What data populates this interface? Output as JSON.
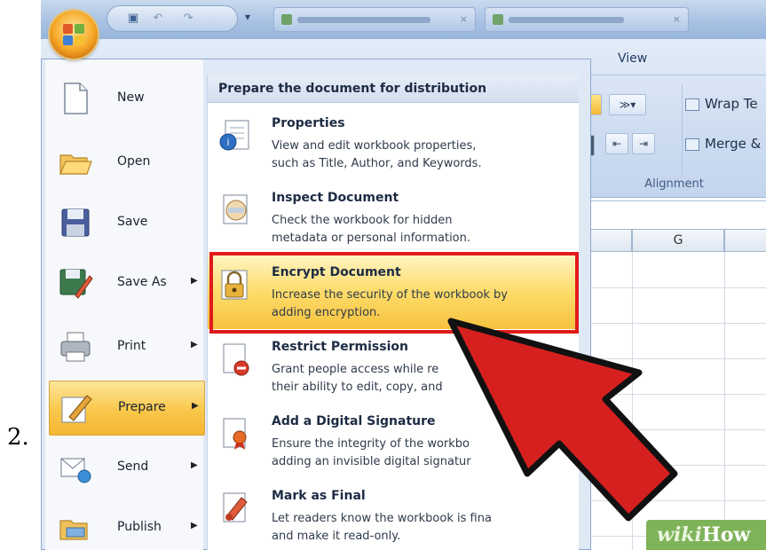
{
  "step_number": "2.",
  "ribbon": {
    "view_tab": "View",
    "wrap_text": "Wrap Te",
    "merge": "Merge &",
    "group_alignment": "Alignment",
    "column_g": "G"
  },
  "office_menu": {
    "left_items": [
      {
        "label": "New",
        "icon": "new-document-icon",
        "submenu": false
      },
      {
        "label": "Open",
        "icon": "open-folder-icon",
        "submenu": false
      },
      {
        "label": "Save",
        "icon": "save-disk-icon",
        "submenu": false
      },
      {
        "label": "Save As",
        "icon": "save-as-icon",
        "submenu": true
      },
      {
        "label": "Print",
        "icon": "printer-icon",
        "submenu": true
      },
      {
        "label": "Prepare",
        "icon": "prepare-pencil-icon",
        "submenu": true,
        "active": true
      },
      {
        "label": "Send",
        "icon": "send-icon",
        "submenu": true
      },
      {
        "label": "Publish",
        "icon": "publish-folder-icon",
        "submenu": true
      }
    ],
    "right_panel": {
      "heading": "Prepare the document for distribution",
      "entries": [
        {
          "title": "Properties",
          "line1": "View and edit workbook properties,",
          "line2": "such as Title, Author, and Keywords.",
          "icon": "properties-icon"
        },
        {
          "title": "Inspect Document",
          "line1": "Check the workbook for hidden",
          "line2": "metadata or personal information.",
          "icon": "inspect-document-icon"
        },
        {
          "title": "Encrypt Document",
          "line1": "Increase the security of the workbook by",
          "line2": "adding encryption.",
          "icon": "encrypt-lock-icon",
          "highlighted": true
        },
        {
          "title": "Restrict Permission",
          "line1": "Grant people access while re",
          "line2": "their ability to edit, copy, and",
          "icon": "restrict-permission-icon"
        },
        {
          "title": "Add a Digital Signature",
          "line1": "Ensure the integrity of the workbo",
          "line2": "adding an invisible digital signatur",
          "icon": "digital-signature-icon"
        },
        {
          "title": "Mark as Final",
          "line1": "Let readers know the workbook is fina",
          "line2": "and make it read-only.",
          "icon": "mark-final-icon"
        }
      ]
    }
  },
  "watermark": {
    "prefix": "wiki",
    "suffix": "How"
  },
  "colors": {
    "highlight_red": "#e01b1b",
    "arrow_red": "#d62020",
    "active_orange": "#f9c74a"
  }
}
